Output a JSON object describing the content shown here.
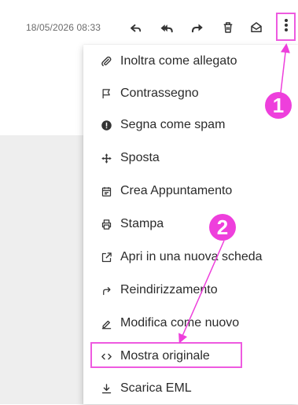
{
  "toolbar": {
    "timestamp": "18/05/2026 08:33",
    "icons": [
      "reply-icon",
      "reply-all-icon",
      "forward-icon",
      "delete-icon",
      "mark-unread-icon",
      "more-options-icon"
    ]
  },
  "menu": {
    "items": [
      {
        "label": "Inoltra come allegato",
        "icon": "paperclip-icon"
      },
      {
        "label": "Contrassegno",
        "icon": "flag-icon"
      },
      {
        "label": "Segna come spam",
        "icon": "spam-icon"
      },
      {
        "label": "Sposta",
        "icon": "move-icon"
      },
      {
        "label": "Crea Appuntamento",
        "icon": "calendar-icon"
      },
      {
        "label": "Stampa",
        "icon": "printer-icon"
      },
      {
        "label": "Apri in una nuova scheda",
        "icon": "open-new-tab-icon"
      },
      {
        "label": "Reindirizzamento",
        "icon": "redirect-icon"
      },
      {
        "label": "Modifica come nuovo",
        "icon": "edit-icon"
      },
      {
        "label": "Mostra originale",
        "icon": "code-icon"
      },
      {
        "label": "Scarica EML",
        "icon": "download-icon"
      }
    ]
  },
  "annotations": {
    "badge_1": "1",
    "badge_2": "2",
    "accent_color": "#ee3fdc"
  }
}
